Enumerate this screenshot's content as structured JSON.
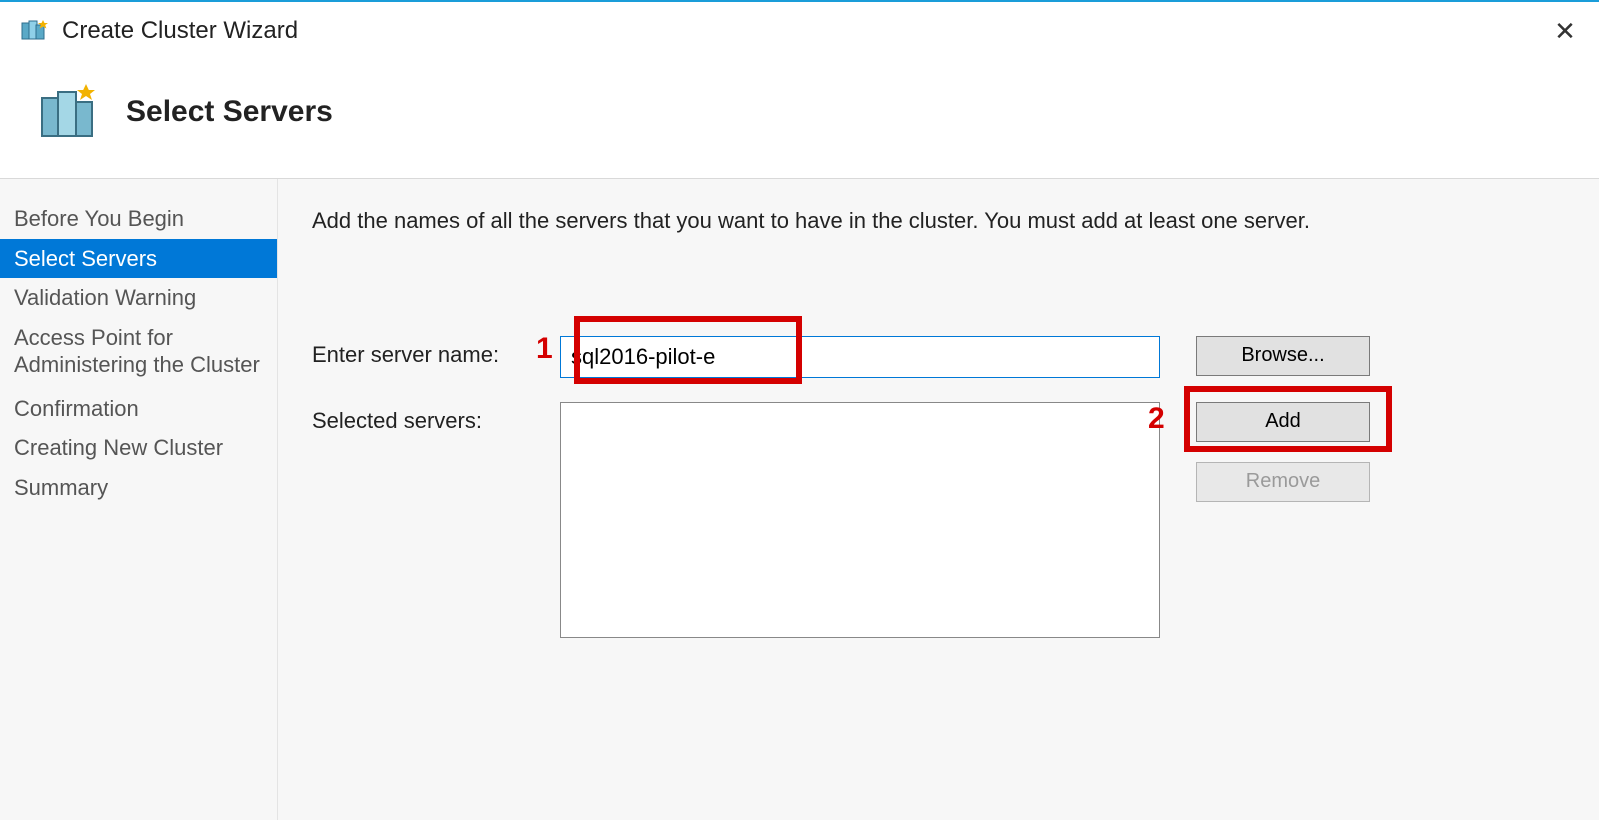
{
  "titlebar": {
    "title": "Create Cluster Wizard",
    "close_glyph": "✕"
  },
  "header": {
    "title": "Select Servers"
  },
  "sidebar": {
    "items": [
      {
        "label": "Before You Begin"
      },
      {
        "label": "Select Servers",
        "selected": true
      },
      {
        "label": "Validation Warning"
      },
      {
        "label": "Access Point for Administering the Cluster"
      },
      {
        "label": "Confirmation"
      },
      {
        "label": "Creating New Cluster"
      },
      {
        "label": "Summary"
      }
    ]
  },
  "main": {
    "instruction": "Add the names of all the servers that you want to have in the cluster. You must add at least one server.",
    "enter_label": "Enter server name:",
    "server_name_value": "sql2016-pilot-e",
    "selected_label": "Selected servers:",
    "browse_label": "Browse...",
    "add_label": "Add",
    "remove_label": "Remove"
  },
  "annotations": {
    "one": "1",
    "two": "2"
  }
}
